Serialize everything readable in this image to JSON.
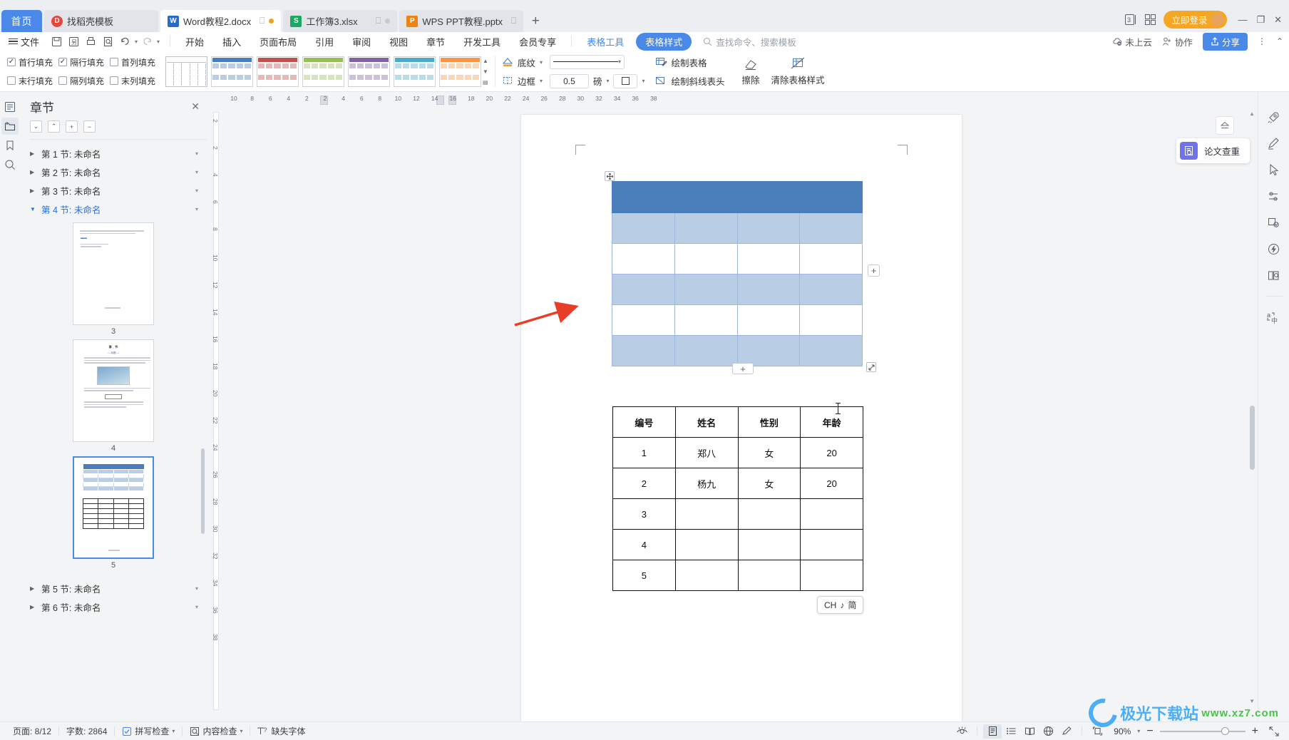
{
  "tabbar": {
    "home_label": "首页",
    "tabs": [
      {
        "name": "找稻壳模板",
        "icon": "daoke-icon",
        "type": "daoke",
        "active": false,
        "show_mini": false,
        "dot": ""
      },
      {
        "name": "Word教程2.docx",
        "icon": "word-icon",
        "type": "word",
        "active": true,
        "show_mini": true,
        "dot": "orange"
      },
      {
        "name": "工作簿3.xlsx",
        "icon": "excel-icon",
        "type": "xls",
        "active": false,
        "show_mini": true,
        "dot": "grey"
      },
      {
        "name": "WPS PPT教程.pptx",
        "icon": "powerpoint-icon",
        "type": "ppt",
        "active": false,
        "show_mini": false,
        "dot": ""
      }
    ],
    "new_tab_label": "+",
    "tab_count_badge": "3",
    "login_label": "立即登录",
    "minimize": "—",
    "maximize": "❐",
    "close": "✕"
  },
  "menubar": {
    "file_label": "文件",
    "quick_access": [
      "save-icon",
      "save-as-icon",
      "print-icon",
      "print-preview-icon",
      "undo-icon",
      "redo-icon",
      "customize-icon"
    ],
    "items": [
      {
        "label": "开始",
        "style": "normal"
      },
      {
        "label": "插入",
        "style": "normal"
      },
      {
        "label": "页面布局",
        "style": "normal"
      },
      {
        "label": "引用",
        "style": "normal"
      },
      {
        "label": "审阅",
        "style": "normal"
      },
      {
        "label": "视图",
        "style": "normal"
      },
      {
        "label": "章节",
        "style": "normal"
      },
      {
        "label": "开发工具",
        "style": "normal"
      },
      {
        "label": "会员专享",
        "style": "normal"
      },
      {
        "label": "表格工具",
        "style": "blue"
      }
    ],
    "active_pill": "表格样式",
    "search_placeholder": "查找命令、搜索模板",
    "cloud_status": "未上云",
    "collab_label": "协作",
    "share_label": "分享",
    "more_icon": "more-vertical-icon",
    "collapse_icon": "chevron-up-icon"
  },
  "ribbon": {
    "checkboxes": [
      {
        "label": "首行填充",
        "checked": true
      },
      {
        "label": "隔行填充",
        "checked": true
      },
      {
        "label": "首列填充",
        "checked": false
      },
      {
        "label": "末行填充",
        "checked": false
      },
      {
        "label": "隔列填充",
        "checked": false
      },
      {
        "label": "末列填充",
        "checked": false
      }
    ],
    "styles": [
      {
        "name": "plain-grid",
        "header": "#ffffff",
        "a": "#ffffff",
        "b": "#ffffff",
        "border": "#bcc1c9"
      },
      {
        "name": "blue-banded",
        "header": "#4a7ebb",
        "a": "#b9cde5",
        "b": "#ffffff",
        "border": "#ffffff"
      },
      {
        "name": "red-banded",
        "header": "#c0504d",
        "a": "#e6b8b7",
        "b": "#ffffff",
        "border": "#ffffff"
      },
      {
        "name": "green-banded",
        "header": "#9bbb59",
        "a": "#d7e4bd",
        "b": "#ffffff",
        "border": "#ffffff"
      },
      {
        "name": "purple-banded",
        "header": "#8064a2",
        "a": "#ccc0da",
        "b": "#ffffff",
        "border": "#ffffff"
      },
      {
        "name": "aqua-banded",
        "header": "#4bacc6",
        "a": "#b7dee8",
        "b": "#ffffff",
        "border": "#ffffff"
      },
      {
        "name": "orange-banded",
        "header": "#f79646",
        "a": "#fcd5b4",
        "b": "#ffffff",
        "border": "#ffffff"
      }
    ],
    "shading_label": "底纹",
    "border_label": "边框",
    "width_value": "0.5",
    "width_unit": "磅",
    "draw_table_label": "绘制表格",
    "draw_diagonal_label": "绘制斜线表头",
    "eraser_label": "擦除",
    "clear_style_label": "清除表格样式"
  },
  "sidebar": {
    "title": "章节",
    "close_icon": "close-icon",
    "tools": [
      "collapse-down-icon",
      "collapse-up-icon",
      "add-section-icon",
      "remove-section-icon"
    ],
    "sections": [
      {
        "label": "第 1 节: 未命名",
        "selected": false,
        "expanded": false
      },
      {
        "label": "第 2 节: 未命名",
        "selected": false,
        "expanded": false
      },
      {
        "label": "第 3 节: 未命名",
        "selected": false,
        "expanded": false
      },
      {
        "label": "第 4 节: 未命名",
        "selected": true,
        "expanded": true
      },
      {
        "label": "第 5 节: 未命名",
        "selected": false,
        "expanded": false
      },
      {
        "label": "第 6 节: 未命名",
        "selected": false,
        "expanded": false
      }
    ],
    "thumbnails": [
      {
        "page": "3",
        "selected": false
      },
      {
        "page": "4",
        "selected": false
      },
      {
        "page": "5",
        "selected": true
      }
    ]
  },
  "ruler": {
    "horizontal": [
      "10",
      "8",
      "6",
      "4",
      "2",
      "2",
      "4",
      "6",
      "8",
      "10",
      "12",
      "14",
      "16",
      "18",
      "20",
      "22",
      "24",
      "26",
      "28",
      "30",
      "32",
      "34",
      "36",
      "38"
    ],
    "vertical": [
      "2",
      "2",
      "4",
      "6",
      "8",
      "10",
      "12",
      "14",
      "16",
      "18",
      "20",
      "22",
      "24",
      "26",
      "28",
      "30",
      "32",
      "34",
      "36",
      "38"
    ]
  },
  "document": {
    "selected_table": {
      "name": "styled-table",
      "columns": 4,
      "rows": 6,
      "header_color": "#4a7ebb",
      "band_color": "#b9cde5",
      "alt_color": "#ffffff",
      "border_color": "#9fb8dd",
      "move_handle_icon": "move-handle-icon",
      "resize_handle_icon": "resize-handle-icon",
      "add_row_label": "+",
      "add_column_label": "+"
    },
    "data_table": {
      "name": "student-table",
      "headers": [
        "编号",
        "姓名",
        "性别",
        "年龄"
      ],
      "rows": [
        [
          "1",
          "郑八",
          "女",
          "20"
        ],
        [
          "2",
          "杨九",
          "女",
          "20"
        ],
        [
          "3",
          "",
          "",
          ""
        ],
        [
          "4",
          "",
          "",
          ""
        ],
        [
          "5",
          "",
          "",
          ""
        ]
      ]
    },
    "ime_indicator": {
      "lang": "CH",
      "mode": "简",
      "icon": "ime-icon"
    }
  },
  "float_panel": {
    "eject_icon": "eject-icon",
    "card_label": "论文查重",
    "card_icon": "paper-check-icon"
  },
  "right_rail": {
    "items": [
      {
        "name": "rocket-icon"
      },
      {
        "name": "highlighter-icon"
      },
      {
        "name": "cursor-icon"
      },
      {
        "name": "settings-slider-icon"
      },
      {
        "name": "screenshot-icon"
      },
      {
        "name": "lightning-shield-icon"
      },
      {
        "name": "book-search-icon"
      },
      {
        "name": "translate-icon"
      }
    ]
  },
  "statusbar": {
    "page_label": "页面: 8/12",
    "word_count_label": "字数: 2864",
    "spell_check_label": "拼写检查",
    "content_check_label": "内容检查",
    "missing_font_label": "缺失字体",
    "eye_icon": "eye-icon",
    "views": [
      {
        "name": "page-view-icon",
        "active": true
      },
      {
        "name": "outline-view-icon",
        "active": false
      },
      {
        "name": "read-view-icon",
        "active": false
      },
      {
        "name": "web-view-icon",
        "active": false
      },
      {
        "name": "edit-view-icon",
        "active": false
      }
    ],
    "fit_icon": "fit-page-icon",
    "zoom_level": "90%",
    "zoom_out": "−",
    "zoom_in": "+",
    "fullscreen_icon": "fullscreen-icon"
  },
  "watermark": {
    "text": "极光下载站",
    "url": "www.xz7.com"
  }
}
